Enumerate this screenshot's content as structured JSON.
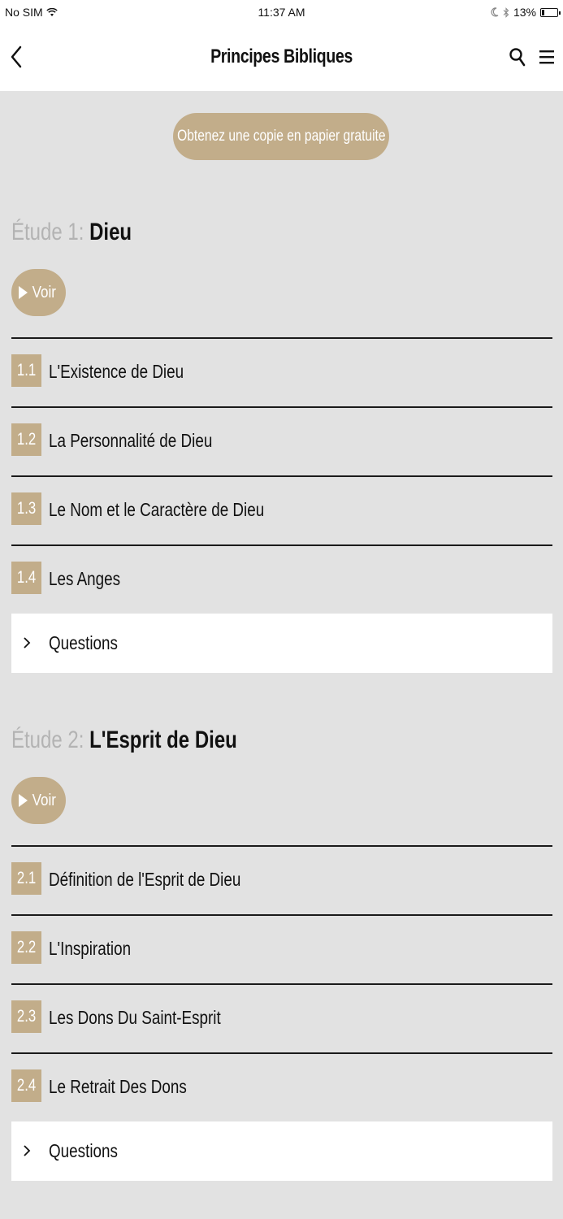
{
  "status_bar": {
    "carrier": "No SIM",
    "time": "11:37 AM",
    "battery": "13%"
  },
  "nav": {
    "title": "Principes Bibliques"
  },
  "free_copy_label": "Obtenez une copie en papier gratuite",
  "studies": [
    {
      "prefix": "Étude 1:",
      "name": "Dieu",
      "watch_label": "Voir",
      "lessons": [
        {
          "num": "1.1",
          "title": "L'Existence de Dieu"
        },
        {
          "num": "1.2",
          "title": "La Personnalité de Dieu"
        },
        {
          "num": "1.3",
          "title": "Le Nom et le Caractère de Dieu"
        },
        {
          "num": "1.4",
          "title": "Les Anges"
        }
      ],
      "questions_label": "Questions"
    },
    {
      "prefix": "Étude 2:",
      "name": "L'Esprit de Dieu",
      "watch_label": "Voir",
      "lessons": [
        {
          "num": "2.1",
          "title": "Définition de l'Esprit de Dieu"
        },
        {
          "num": "2.2",
          "title": "L'Inspiration"
        },
        {
          "num": "2.3",
          "title": "Les Dons Du Saint-Esprit"
        },
        {
          "num": "2.4",
          "title": "Le Retrait Des Dons"
        }
      ],
      "questions_label": "Questions"
    }
  ],
  "colors": {
    "accent": "#c2ad8a",
    "background": "#e2e2e2",
    "bar": "#ffffff",
    "muted_text": "#b3b3b3"
  },
  "icons": [
    "wifi-icon",
    "moon-icon",
    "bluetooth-icon",
    "battery-icon",
    "back-chevron-icon",
    "search-icon",
    "menu-icon",
    "play-icon",
    "chevron-right-icon"
  ]
}
